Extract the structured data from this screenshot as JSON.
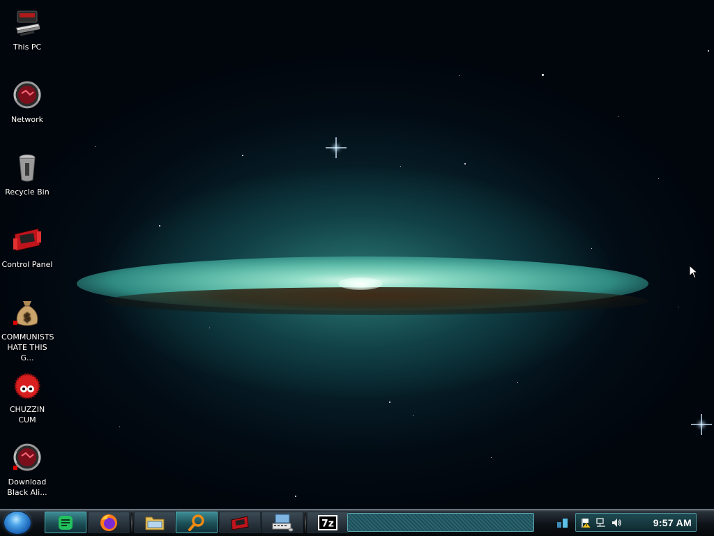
{
  "desktop": {
    "icons": [
      {
        "label": "This PC",
        "icon": "computer-icon"
      },
      {
        "label": "Network",
        "icon": "network-icon"
      },
      {
        "label": "Recycle Bin",
        "icon": "recycle-bin-icon"
      },
      {
        "label": "Control Panel",
        "icon": "control-panel-icon"
      },
      {
        "label": "COMMUNISTS HATE THIS G...",
        "icon": "money-bag-icon"
      },
      {
        "label": "CHUZZIN CUM",
        "icon": "chuzzle-icon"
      },
      {
        "label": "Download Black Ali...",
        "icon": "alien-icon"
      }
    ]
  },
  "taskbar": {
    "start_icon": "start-orb-icon",
    "buttons": [
      {
        "icon": "notepad-icon",
        "active": true
      },
      {
        "icon": "firefox-icon",
        "active": false
      },
      {
        "icon": "file-explorer-icon",
        "active": false
      },
      {
        "icon": "search-icon",
        "active": true
      },
      {
        "icon": "control-panel-icon",
        "active": false
      },
      {
        "icon": "on-screen-keyboard-icon",
        "active": false
      },
      {
        "icon": "7zip-icon",
        "active": false
      }
    ],
    "tray": {
      "show_desktop_icon": "show-desktop-icon",
      "icons": [
        "action-center-flag-icon",
        "network-icon",
        "volume-icon"
      ],
      "clock": "9:57 AM"
    }
  },
  "colors": {
    "taskbar_accent": "#4fb3b8",
    "galaxy_glow": "#8fdcc6",
    "start_orb": "#4aa3e8"
  }
}
